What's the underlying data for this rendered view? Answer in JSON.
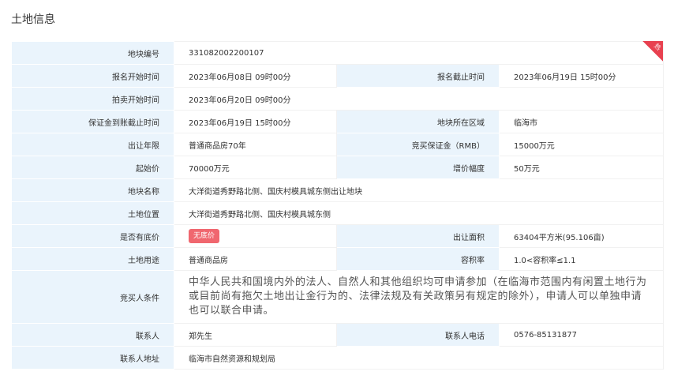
{
  "section_title": "土地信息",
  "corner_badge": "热",
  "rows": {
    "parcel_no": {
      "label": "地块编号",
      "value": "331082002200107"
    },
    "signup_start": {
      "label": "报名开始时间",
      "value": "2023年06月08日 09时00分"
    },
    "signup_end": {
      "label": "报名截止时间",
      "value": "2023年06月19日 15时00分"
    },
    "auction_start": {
      "label": "拍卖开始时间",
      "value": "2023年06月20日 09时00分"
    },
    "deposit_deadline": {
      "label": "保证金到账截止时间",
      "value": "2023年06月19日 15时00分"
    },
    "region": {
      "label": "地块所在区域",
      "value": "临海市"
    },
    "term": {
      "label": "出让年限",
      "value": "普通商品房70年"
    },
    "deposit": {
      "label": "竞买保证金（RMB）",
      "value": "15000万元"
    },
    "start_price": {
      "label": "起始价",
      "value": "70000万元"
    },
    "increment": {
      "label": "增价幅度",
      "value": "50万元"
    },
    "name": {
      "label": "地块名称",
      "value": "大洋街道秀野路北侧、国庆村模具城东侧出让地块"
    },
    "location": {
      "label": "土地位置",
      "value": "大洋街道秀野路北侧、国庆村模具城东侧"
    },
    "reserve": {
      "label": "是否有底价",
      "value": "无底价"
    },
    "area": {
      "label": "出让面积",
      "value": "63404平方米(95.106亩)"
    },
    "usage": {
      "label": "土地用途",
      "value": "普通商品房"
    },
    "far": {
      "label": "容积率",
      "value": "1.0<容积率≤1.1"
    },
    "conditions": {
      "label": "竞买人条件",
      "value": "中华人民共和国境内外的法人、自然人和其他组织均可申请参加（在临海市范围内有闲置土地行为或目前尚有拖欠土地出让金行为的、法律法规及有关政策另有规定的除外），申请人可以单独申请也可以联合申请。"
    },
    "contact": {
      "label": "联系人",
      "value": "郑先生"
    },
    "phone": {
      "label": "联系人电话",
      "value": "0576-85131877"
    },
    "address": {
      "label": "联系人地址",
      "value": "临海市自然资源和规划局"
    }
  }
}
